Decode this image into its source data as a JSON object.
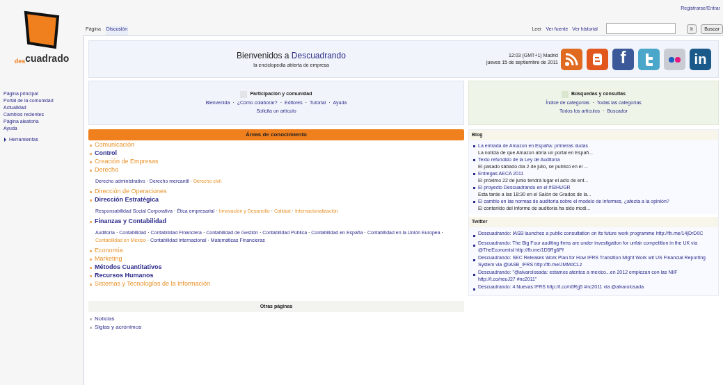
{
  "logo": {
    "prefix": "des",
    "text": "cuadrado"
  },
  "separator": "·",
  "sidebar": {
    "items": [
      "Página principal",
      "Portal de la comunidad",
      "Actualidad",
      "Cambios recientes",
      "Página aleatoria",
      "Ayuda"
    ],
    "toolbox": {
      "label": "Herramientas",
      "expanded": false
    }
  },
  "user_link": "Registrarse/Entrar",
  "tabs_left": [
    {
      "label": "Página",
      "selected": true
    },
    {
      "label": "Discusión",
      "selected": false
    }
  ],
  "tabs_right": [
    {
      "label": "Leer",
      "selected": true
    },
    {
      "label": "Ver fuente",
      "selected": false
    },
    {
      "label": "Ver historial",
      "selected": false
    }
  ],
  "search": {
    "go_button": "Ir",
    "search_button": "Buscar"
  },
  "welcome": {
    "title_start": "Bienvenidos a ",
    "title_link": "Descuadrando",
    "subtitle": "la enciclopedia abierta de empresa",
    "time": "12:03 (GMT+1) Madrid",
    "date": "jueves 15 de septiembre de 2011"
  },
  "social": [
    {
      "kind": "rss"
    },
    {
      "kind": "blogger"
    },
    {
      "kind": "facebook",
      "label": "f"
    },
    {
      "kind": "twitter"
    },
    {
      "kind": "flickr"
    },
    {
      "kind": "linkedin",
      "label": "in"
    }
  ],
  "participation": {
    "title": "Participación y comunidad",
    "links": [
      "Bienvenida",
      "¿Cómo colaborar?",
      "Editores",
      "Tutorial",
      "Ayuda"
    ],
    "extra_link": "Solicita un artículo"
  },
  "search_box": {
    "title": "Búsquedas y consultas",
    "links": [
      "Índice de categorías",
      "Todas las categorías"
    ],
    "links2": [
      "Todos los artículos",
      "Buscador"
    ]
  },
  "areas": {
    "title": "Áreas de conocimiento",
    "items": [
      {
        "title": "Comunicación",
        "kind": "new"
      },
      {
        "title": "Control",
        "kind": "link"
      },
      {
        "title": "Creación de Empresas",
        "kind": "new"
      },
      {
        "title": "Derecho",
        "kind": "new",
        "sublinks": [
          {
            "text": "Derecho administrativo",
            "kind": "link"
          },
          {
            "text": "Derecho mercantil",
            "kind": "link"
          },
          {
            "text": "Derecho civil",
            "kind": "new"
          }
        ]
      },
      {
        "title": "Dirección de Operaciones",
        "kind": "new"
      },
      {
        "title": "Dirección Estratégica",
        "kind": "link",
        "sublinks": [
          {
            "text": "Responsabilidad Social Corporativa",
            "kind": "link"
          },
          {
            "text": "Ética empresarial",
            "kind": "link"
          },
          {
            "text": "Innovación y Desarrollo",
            "kind": "new"
          },
          {
            "text": "Calidad",
            "kind": "new"
          },
          {
            "text": "Internacionalización",
            "kind": "new"
          }
        ]
      },
      {
        "title": "Finanzas y Contabilidad",
        "kind": "link",
        "sublinks": [
          {
            "text": "Auditoría",
            "kind": "link"
          },
          {
            "text": "Contabilidad",
            "kind": "link"
          },
          {
            "text": "Contabilidad Financiera",
            "kind": "link"
          },
          {
            "text": "Contabilidad de Gestión",
            "kind": "link"
          },
          {
            "text": "Contabilidad Pública",
            "kind": "link"
          },
          {
            "text": "Contabilidad en España",
            "kind": "link"
          },
          {
            "text": "Contabilidad en la Unión Europea",
            "kind": "link"
          },
          {
            "text": "Contabilidad en México",
            "kind": "new"
          },
          {
            "text": "Contabilidad internacional",
            "kind": "link"
          },
          {
            "text": "Matemáticas Financieras",
            "kind": "link"
          }
        ]
      },
      {
        "title": "Economía",
        "kind": "new"
      },
      {
        "title": "Marketing",
        "kind": "new"
      },
      {
        "title": "Métodos Cuantitativos",
        "kind": "link"
      },
      {
        "title": "Recursos Humanos",
        "kind": "link"
      },
      {
        "title": "Sistemas y Tecnologías de la Información",
        "kind": "new"
      }
    ]
  },
  "other_pages": {
    "title": "Otras páginas",
    "items": [
      "Noticias",
      "Siglas y acrónimos"
    ]
  },
  "blog": {
    "title": "Blog",
    "items": [
      {
        "title": "La entrada de Amazon en España: primeras dudas",
        "excerpt": "La noticia de que Amazon abría un portal en Españ..."
      },
      {
        "title": "Texto refundido de la Ley de Auditoría",
        "excerpt": "El pasado sábado día 2 de julio, se publicó en el ..."
      },
      {
        "title": "Entregas AECA 2011",
        "excerpt": "El próximo 22 de junio tendrá lugar el acto de ent..."
      },
      {
        "title": "El proyecto Descuadrando en el #SIHUGR",
        "excerpt": "Esta tarde a las 18:30 en el Salón de Grados de la..."
      },
      {
        "title": "El cambio en las normas de auditoría sobre el modelo de informes, ¿afecta a la opinión?",
        "excerpt": "El contenido del informe de auditoría ha sido modi..."
      }
    ]
  },
  "twitter": {
    "title": "Twitter",
    "items": [
      "Descuadrando: IASB launches a public consultation on its future work programme http://fb.me/14jDrD0C",
      "Descuadrando: The Big Four auditing firms are under investigation for unfair competition in the UK via @TheEconomist http://fb.me/1D5Rg6Pf",
      "Descuadrando: SEC Releases Work Plan for How IFRS Transition Might Work wit US Financial Reporting System via @IASB_IFRS http://fb.me/JMMdCLz",
      "Descuadrando: \"@alvarolosada: estamos atentos a mexico...en 2012 empiezan con las NIIF http://t.co/neuJ27 #nc2011\"",
      "Descuadrando: 4 Nuevas IFRS http://t.co/n0Rg5 #nc2011 via @alvarolosada"
    ]
  }
}
